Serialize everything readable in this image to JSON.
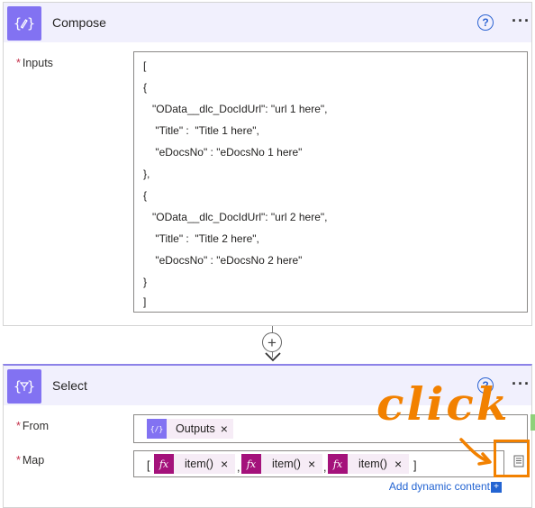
{
  "compose": {
    "title": "Compose",
    "help_glyph": "?",
    "more_glyph": "···",
    "icon": "braces-pencil-icon",
    "inputs_label": "Inputs",
    "required_mark": "*",
    "code_lines": [
      "[",
      "{",
      "   \"OData__dlc_DocIdUrl\": \"url 1 here\",",
      "    \"Title\" :  \"Title 1 here\",",
      "    \"eDocsNo\" : \"eDocsNo 1 here\"",
      "},",
      "{",
      "   \"OData__dlc_DocIdUrl\": \"url 2 here\",",
      "    \"Title\" :  \"Title 2 here\",",
      "    \"eDocsNo\" : \"eDocsNo 2 here\"",
      "}",
      "]"
    ]
  },
  "connector": {
    "plus_glyph": "+"
  },
  "select": {
    "title": "Select",
    "help_glyph": "?",
    "more_glyph": "···",
    "icon": "braces-filter-icon",
    "from_label": "From",
    "map_label": "Map",
    "required_mark": "*",
    "from_token": {
      "label": "Outputs",
      "remove_glyph": "×",
      "icon_glyph": "{/}"
    },
    "map_open_bracket": "[",
    "map_close_bracket": "]",
    "map_separator": ",",
    "map_tokens": [
      {
        "label": "item()",
        "remove_glyph": "×",
        "icon_glyph": "fx"
      },
      {
        "label": "item()",
        "remove_glyph": "×",
        "icon_glyph": "fx"
      },
      {
        "label": "item()",
        "remove_glyph": "×",
        "icon_glyph": "fx"
      }
    ],
    "add_dynamic_content": "Add dynamic content",
    "dynamic_badge": "+"
  },
  "annotation": {
    "text": "click",
    "color": "#f28100"
  },
  "colors": {
    "accent": "#8272f2",
    "header_bg": "#f1f0fd",
    "token_bg": "#f6ecf6",
    "fx_token_icon": "#a4127b",
    "outputs_token_icon": "#8272f2",
    "link": "#2364d2",
    "required": "#c4314b"
  }
}
